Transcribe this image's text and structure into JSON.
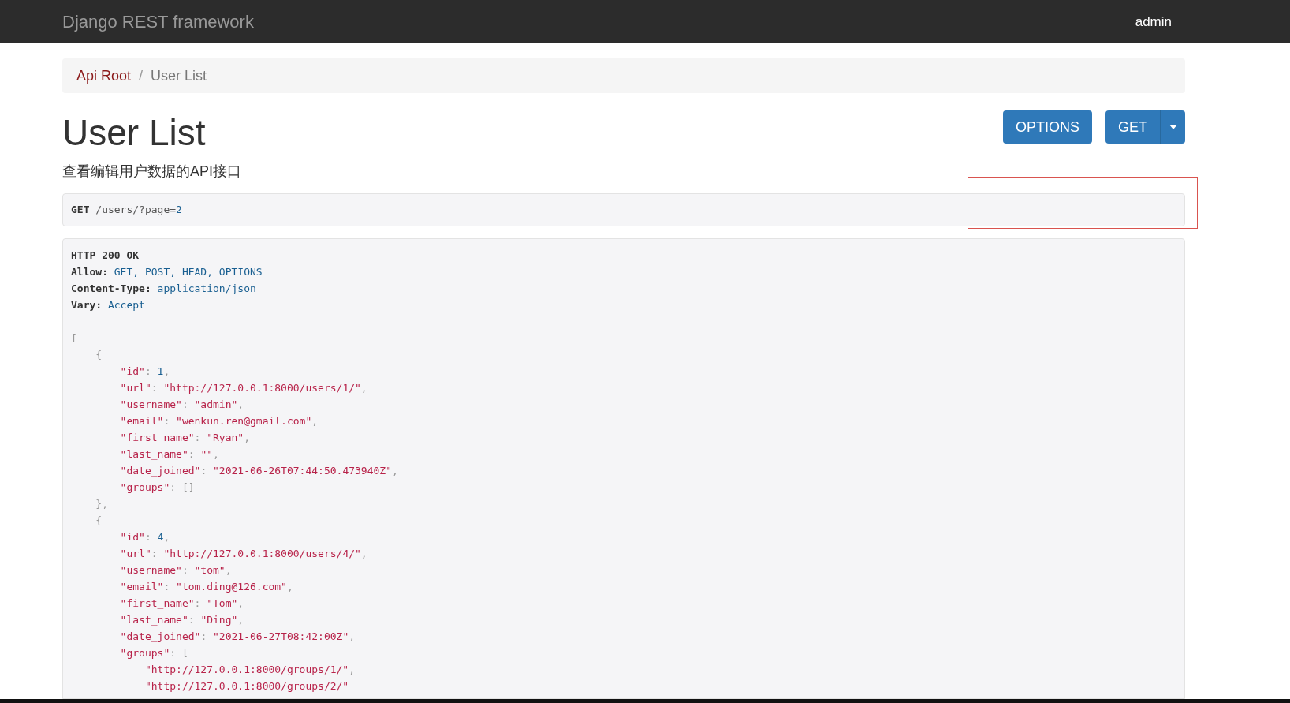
{
  "navbar": {
    "brand": "Django REST framework",
    "user": "admin"
  },
  "breadcrumb_separator": "/",
  "breadcrumb": [
    {
      "label": "Api Root",
      "active": false
    },
    {
      "label": "User List",
      "active": true
    }
  ],
  "title": "User List",
  "description": "查看编辑用户数据的API接口",
  "buttons": [
    {
      "label": "OPTIONS",
      "kind": "plain"
    },
    {
      "label": "GET",
      "kind": "split"
    }
  ],
  "request": {
    "method": "GET",
    "path": "/users/?page=",
    "query_value": "2"
  },
  "response": {
    "headers": [
      {
        "tokens": [
          {
            "kind": "bold",
            "text": "HTTP 200 OK"
          }
        ]
      },
      {
        "tokens": [
          {
            "kind": "bold",
            "text": "Allow:"
          },
          {
            "kind": "value",
            "text": " GET, POST, HEAD, OPTIONS"
          }
        ]
      },
      {
        "tokens": [
          {
            "kind": "bold",
            "text": "Content-Type:"
          },
          {
            "kind": "value",
            "text": " application/json"
          }
        ]
      },
      {
        "tokens": [
          {
            "kind": "bold",
            "text": "Vary:"
          },
          {
            "kind": "value",
            "text": " Accept"
          }
        ]
      }
    ],
    "body": [
      {
        "tokens": [
          {
            "kind": "punct",
            "text": "["
          }
        ]
      },
      {
        "tokens": [
          {
            "kind": "punct",
            "text": "    {"
          }
        ]
      },
      {
        "tokens": [
          {
            "kind": "string",
            "text": "        \"id\""
          },
          {
            "kind": "punct",
            "text": ": "
          },
          {
            "kind": "number",
            "text": "1"
          },
          {
            "kind": "punct",
            "text": ","
          }
        ]
      },
      {
        "tokens": [
          {
            "kind": "string",
            "text": "        \"url\""
          },
          {
            "kind": "punct",
            "text": ": "
          },
          {
            "kind": "string",
            "text": "\"http://127.0.0.1:8000/users/1/\""
          },
          {
            "kind": "punct",
            "text": ","
          }
        ]
      },
      {
        "tokens": [
          {
            "kind": "string",
            "text": "        \"username\""
          },
          {
            "kind": "punct",
            "text": ": "
          },
          {
            "kind": "string",
            "text": "\"admin\""
          },
          {
            "kind": "punct",
            "text": ","
          }
        ]
      },
      {
        "tokens": [
          {
            "kind": "string",
            "text": "        \"email\""
          },
          {
            "kind": "punct",
            "text": ": "
          },
          {
            "kind": "string",
            "text": "\"wenkun.ren@gmail.com\""
          },
          {
            "kind": "punct",
            "text": ","
          }
        ]
      },
      {
        "tokens": [
          {
            "kind": "string",
            "text": "        \"first_name\""
          },
          {
            "kind": "punct",
            "text": ": "
          },
          {
            "kind": "string",
            "text": "\"Ryan\""
          },
          {
            "kind": "punct",
            "text": ","
          }
        ]
      },
      {
        "tokens": [
          {
            "kind": "string",
            "text": "        \"last_name\""
          },
          {
            "kind": "punct",
            "text": ": "
          },
          {
            "kind": "string",
            "text": "\"\""
          },
          {
            "kind": "punct",
            "text": ","
          }
        ]
      },
      {
        "tokens": [
          {
            "kind": "string",
            "text": "        \"date_joined\""
          },
          {
            "kind": "punct",
            "text": ": "
          },
          {
            "kind": "string",
            "text": "\"2021-06-26T07:44:50.473940Z\""
          },
          {
            "kind": "punct",
            "text": ","
          }
        ]
      },
      {
        "tokens": [
          {
            "kind": "string",
            "text": "        \"groups\""
          },
          {
            "kind": "punct",
            "text": ": []"
          }
        ]
      },
      {
        "tokens": [
          {
            "kind": "punct",
            "text": "    },"
          }
        ]
      },
      {
        "tokens": [
          {
            "kind": "punct",
            "text": "    {"
          }
        ]
      },
      {
        "tokens": [
          {
            "kind": "string",
            "text": "        \"id\""
          },
          {
            "kind": "punct",
            "text": ": "
          },
          {
            "kind": "number",
            "text": "4"
          },
          {
            "kind": "punct",
            "text": ","
          }
        ]
      },
      {
        "tokens": [
          {
            "kind": "string",
            "text": "        \"url\""
          },
          {
            "kind": "punct",
            "text": ": "
          },
          {
            "kind": "string",
            "text": "\"http://127.0.0.1:8000/users/4/\""
          },
          {
            "kind": "punct",
            "text": ","
          }
        ]
      },
      {
        "tokens": [
          {
            "kind": "string",
            "text": "        \"username\""
          },
          {
            "kind": "punct",
            "text": ": "
          },
          {
            "kind": "string",
            "text": "\"tom\""
          },
          {
            "kind": "punct",
            "text": ","
          }
        ]
      },
      {
        "tokens": [
          {
            "kind": "string",
            "text": "        \"email\""
          },
          {
            "kind": "punct",
            "text": ": "
          },
          {
            "kind": "string",
            "text": "\"tom.ding@126.com\""
          },
          {
            "kind": "punct",
            "text": ","
          }
        ]
      },
      {
        "tokens": [
          {
            "kind": "string",
            "text": "        \"first_name\""
          },
          {
            "kind": "punct",
            "text": ": "
          },
          {
            "kind": "string",
            "text": "\"Tom\""
          },
          {
            "kind": "punct",
            "text": ","
          }
        ]
      },
      {
        "tokens": [
          {
            "kind": "string",
            "text": "        \"last_name\""
          },
          {
            "kind": "punct",
            "text": ": "
          },
          {
            "kind": "string",
            "text": "\"Ding\""
          },
          {
            "kind": "punct",
            "text": ","
          }
        ]
      },
      {
        "tokens": [
          {
            "kind": "string",
            "text": "        \"date_joined\""
          },
          {
            "kind": "punct",
            "text": ": "
          },
          {
            "kind": "string",
            "text": "\"2021-06-27T08:42:00Z\""
          },
          {
            "kind": "punct",
            "text": ","
          }
        ]
      },
      {
        "tokens": [
          {
            "kind": "string",
            "text": "        \"groups\""
          },
          {
            "kind": "punct",
            "text": ": ["
          }
        ]
      },
      {
        "tokens": [
          {
            "kind": "string",
            "text": "            \"http://127.0.0.1:8000/groups/1/\""
          },
          {
            "kind": "punct",
            "text": ","
          }
        ]
      },
      {
        "tokens": [
          {
            "kind": "string",
            "text": "            \"http://127.0.0.1:8000/groups/2/\""
          }
        ]
      }
    ]
  }
}
